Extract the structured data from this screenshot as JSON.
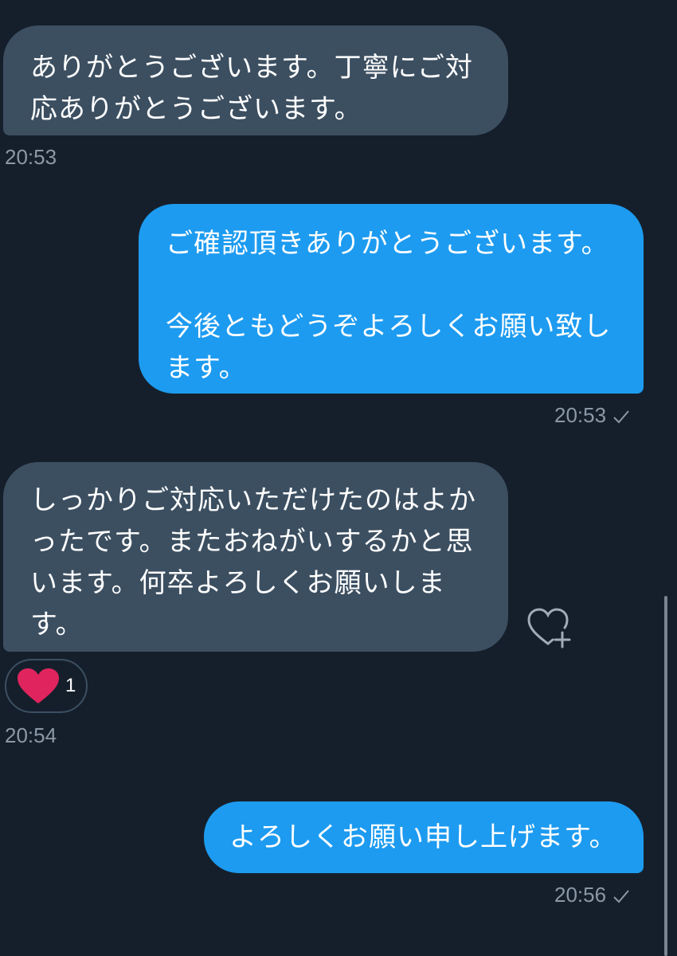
{
  "messages": [
    {
      "direction": "received",
      "text": "ありがとうございます。丁寧にご対応ありがとうございます。",
      "time": "20:53"
    },
    {
      "direction": "sent",
      "text": "ご確認頂きありがとうございます。\n\n今後ともどうぞよろしくお願い致します。",
      "time": "20:53",
      "status_icon": "sent-check-icon"
    },
    {
      "direction": "received",
      "text": "しっかりご対応いただけたのはよかったです。またおねがいするかと思います。何卒よろしくお願いします。",
      "time": "20:54",
      "reaction": {
        "icon": "heart-icon",
        "count": "1"
      },
      "add_reaction_icon": "heart-plus-icon"
    },
    {
      "direction": "sent",
      "text": "よろしくお願い申し上げます。",
      "time": "20:56",
      "status_icon": "sent-check-icon"
    }
  ],
  "colors": {
    "background": "#151f2b",
    "received_bubble": "#3c4f61",
    "sent_bubble": "#1d9bf0",
    "timestamp": "#8b98a5",
    "heart": "#e0245e"
  }
}
